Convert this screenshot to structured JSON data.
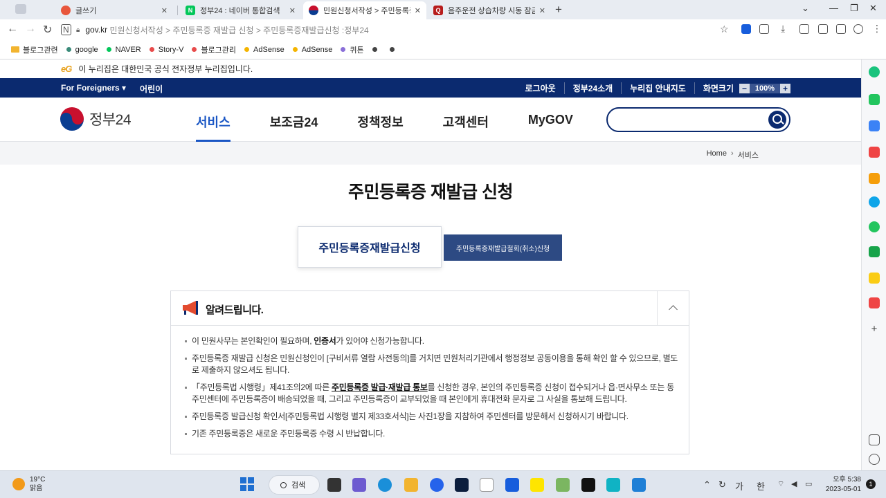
{
  "browser": {
    "tabs": [
      {
        "title": "글쓰기",
        "active": false,
        "favicon_color": "#e8563c"
      },
      {
        "title": "정부24 : 네이버 통합검색",
        "active": false,
        "favicon_color": "#03c75a",
        "favicon_text": "N"
      },
      {
        "title": "민원신청서작성 > 주민등록증 재",
        "active": true,
        "favicon_color": "#0a3d91"
      },
      {
        "title": "음주운전 상습차량 시동 잠금",
        "active": false,
        "favicon_color": "#b71c1c",
        "favicon_text": "Q"
      }
    ],
    "url_host": "gov.kr",
    "url_path": "민원신청서작성 > 주민등록증 재발급 신청 > 주민등록증재발급신청 :정부24",
    "bookmarks": [
      {
        "label": "블로그관련",
        "kind": "folder",
        "color": "#f2b42f"
      },
      {
        "label": "google",
        "color": "#3b8b7a"
      },
      {
        "label": "NAVER",
        "color": "#03c75a"
      },
      {
        "label": "Story-V",
        "color": "#e84b4b"
      },
      {
        "label": "블로그관리",
        "color": "#e84b4b"
      },
      {
        "label": "AdSense",
        "color": "#f4b400"
      },
      {
        "label": "AdSense",
        "color": "#f4b400"
      },
      {
        "label": "퀴튼",
        "color": "#8a6fd8"
      },
      {
        "label": "",
        "color": "#444444"
      },
      {
        "label": "",
        "color": "#444444"
      }
    ]
  },
  "site": {
    "gov_banner": {
      "eg_logo": "eG",
      "text": "이 누리집은 대한민국 공식 전자정부 누리집입니다."
    },
    "util_left": [
      "For Foreigners ▾",
      "어린이"
    ],
    "util_right": [
      "로그아웃",
      "정부24소개",
      "누리집 안내지도",
      "화면크기"
    ],
    "zoom": {
      "minus": "−",
      "value": "100%",
      "plus": "+"
    },
    "logo_text": "정부24",
    "nav": [
      {
        "label": "서비스",
        "active": true
      },
      {
        "label": "보조금24",
        "active": false
      },
      {
        "label": "정책정보",
        "active": false
      },
      {
        "label": "고객센터",
        "active": false
      },
      {
        "label": "MyGOV",
        "active": false
      }
    ],
    "search_placeholder": "",
    "breadcrumb": [
      "Home",
      "서비스"
    ],
    "page_title": "주민등록증 재발급 신청",
    "tab_primary": "주민등록증재발급신청",
    "tab_secondary": "주민등록증재발급철회(취소)신청",
    "notice": {
      "title": "알려드립니다.",
      "items": [
        {
          "pre": "이 민원사무는 본인확인이 필요하며, ",
          "bold": "인증서",
          "post": "가 있어야 신청가능합니다."
        },
        {
          "pre": "주민등록증 재발급 신청은 민원신청인이 [구비서류 열람 사전동의]를 거치면 민원처리기관에서 행정정보 공동이용을 통해 확인 할 수 있으므로, 별도로 제출하지 않으셔도 됩니다.",
          "bold": "",
          "post": ""
        },
        {
          "pre": "「주민등록법 시행령」제41조의2에 따른 ",
          "bold": "주민등록증 발급·재발급 통보",
          "post": "를 신청한 경우, 본인의 주민등록증 신청이 접수되거나 읍·면사무소 또는 동 주민센터에 주민등록증이 배송되었을 때, 그리고 주민등록증이 교부되었을 때 본인에게 휴대전화 문자로 그 사실을 통보해 드립니다."
        },
        {
          "pre": "주민등록증 발급신청 확인서[주민등록법 시행령 별지 제33호서식]는 사진1장을 지참하여 주민센터를 방문해서 신청하시기 바랍니다.",
          "bold": "",
          "post": ""
        },
        {
          "pre": "기존 주민등록증은 새로운 주민등록증 수령 시 반납합니다.",
          "bold": "",
          "post": ""
        }
      ]
    }
  },
  "taskbar": {
    "temp": "19°C",
    "weather": "맑음",
    "search_label": "검색",
    "kbd_lang": "가",
    "kbd_mode": "한",
    "time": "오후 5:38",
    "date": "2023-05-01",
    "notif_count": "1"
  }
}
